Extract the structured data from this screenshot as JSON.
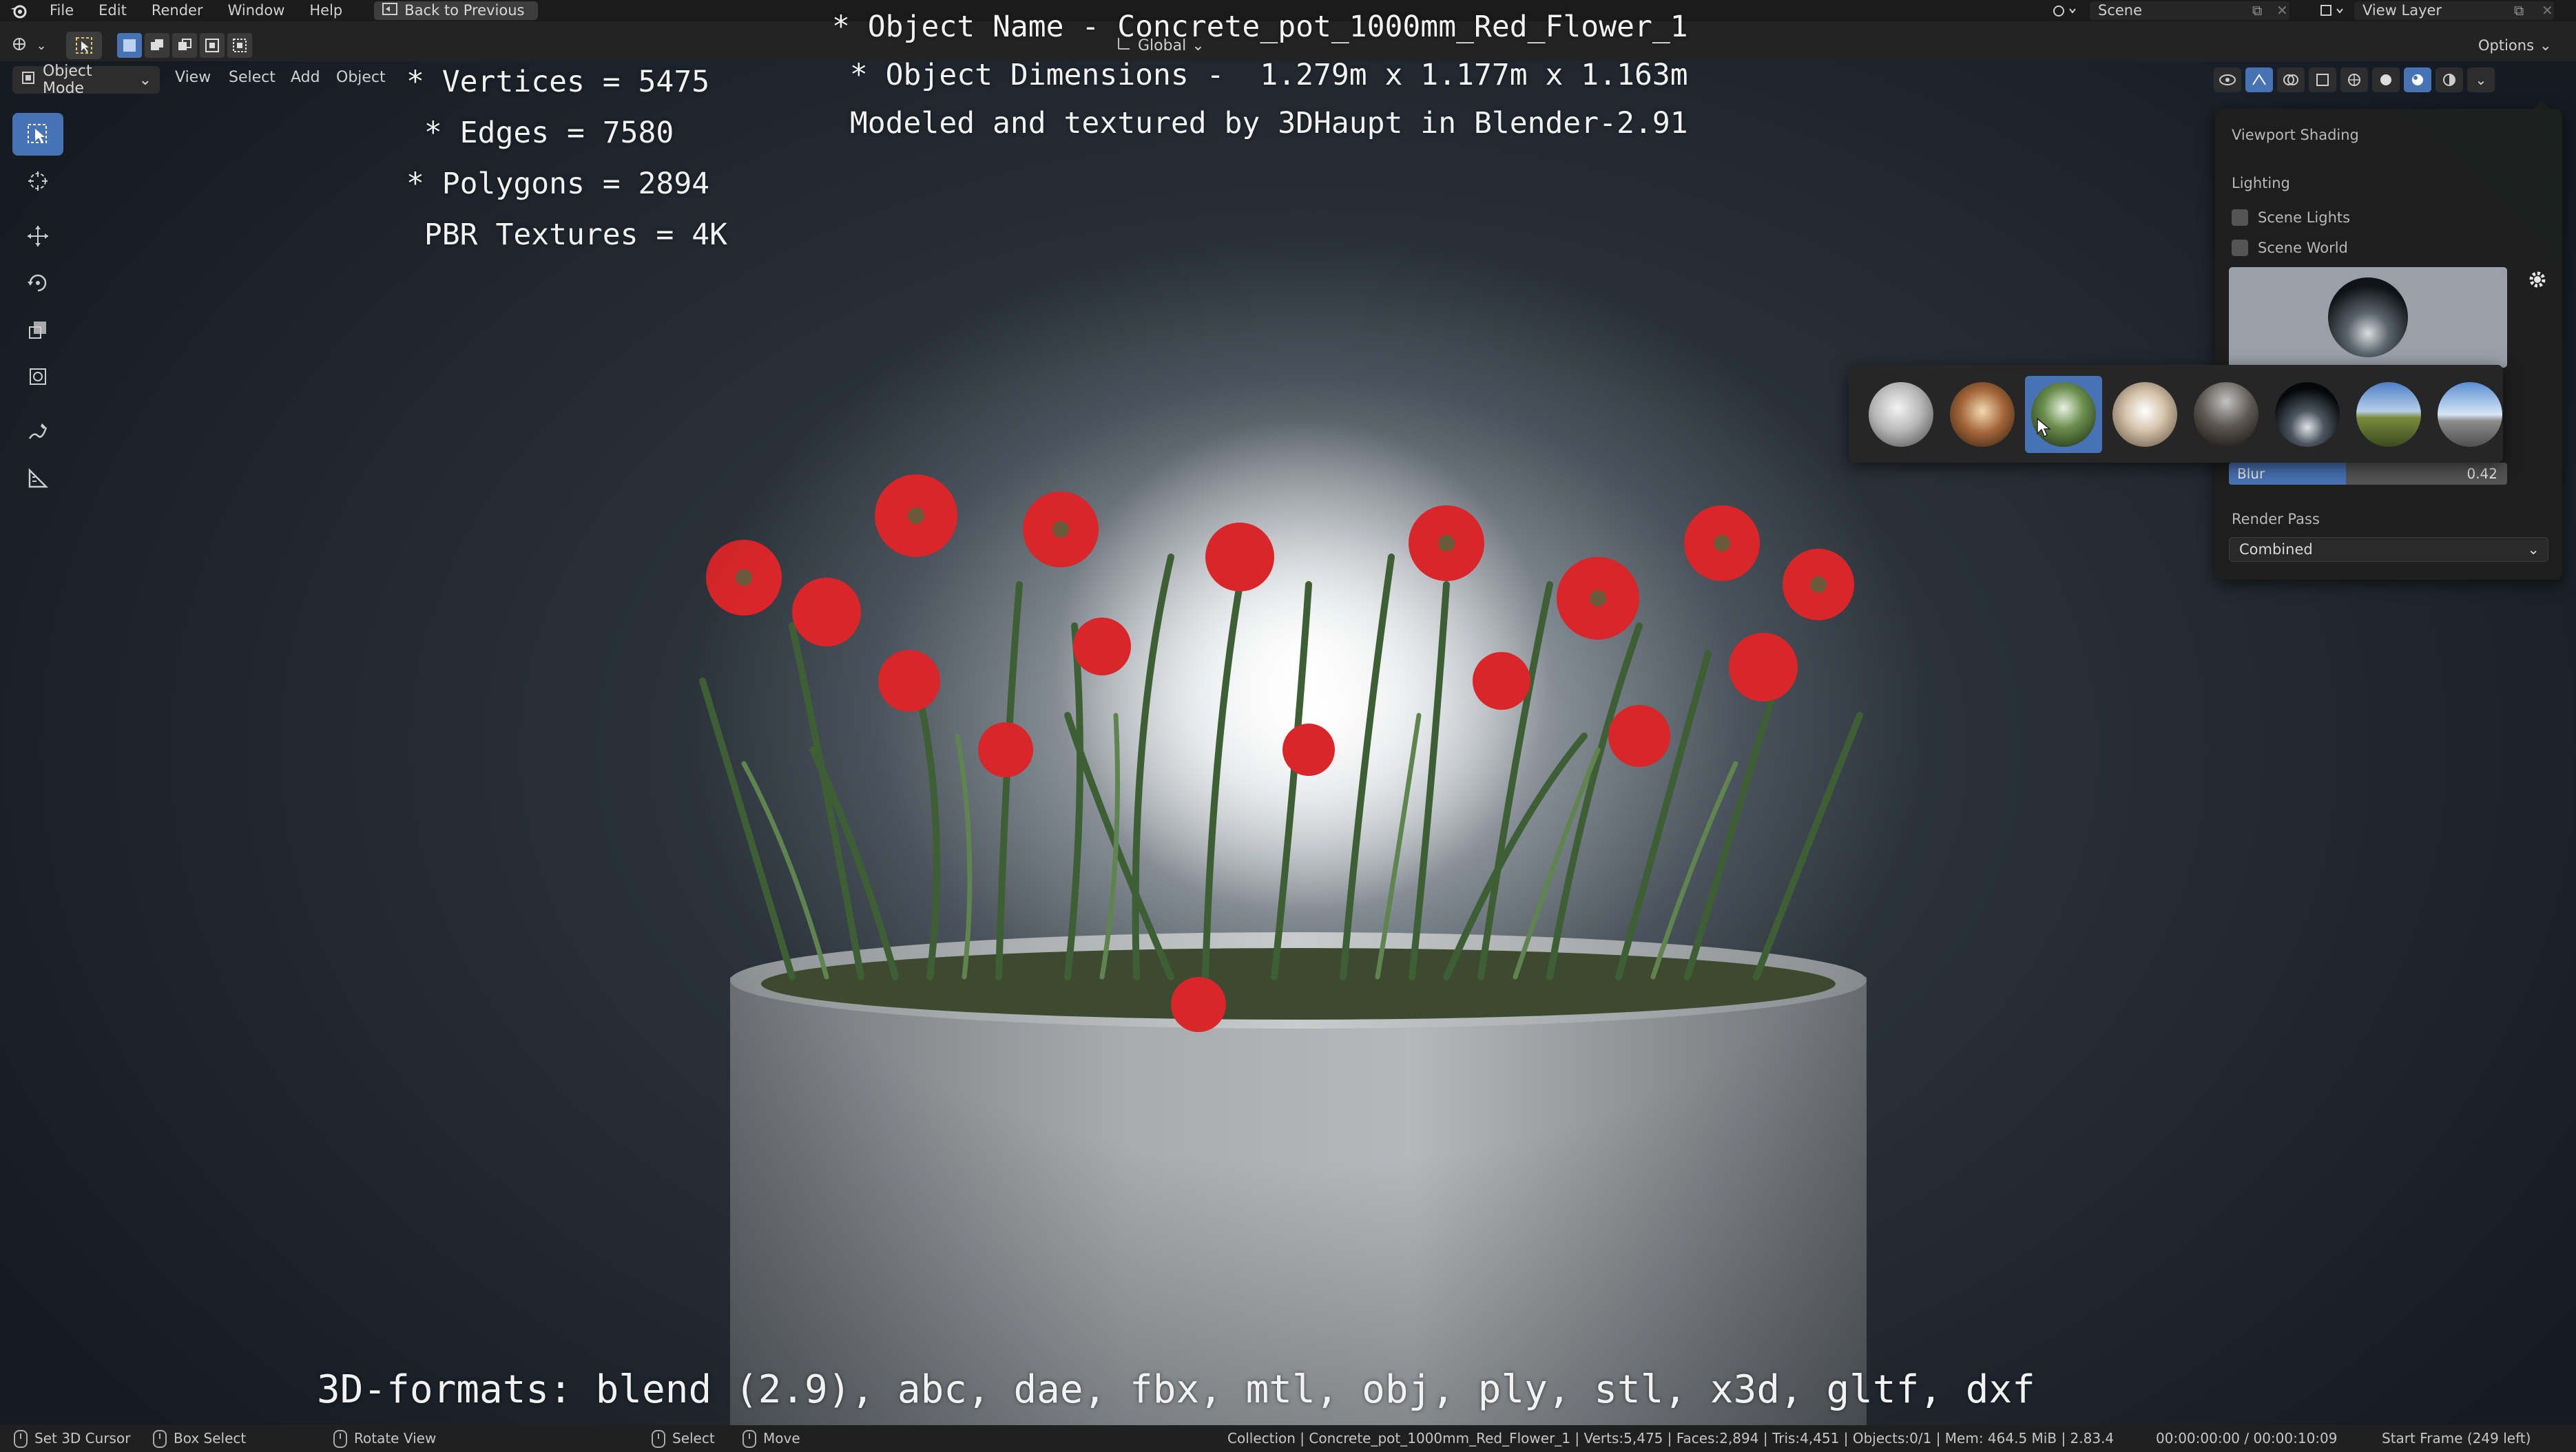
{
  "topbar": {
    "menus": [
      "File",
      "Edit",
      "Render",
      "Window",
      "Help"
    ],
    "back_button": "Back to Previous",
    "scene": "Scene",
    "view_layer": "View Layer"
  },
  "header": {
    "mode": "Object Mode",
    "menus": [
      "View",
      "Select",
      "Add",
      "Object"
    ],
    "orientation": "Global",
    "options_label": "Options"
  },
  "overlay": {
    "stats": [
      "* Vertices = 5475",
      " * Edges = 7580",
      "* Polygons = 2894",
      " PBR Textures = 4K"
    ],
    "object_name": "* Object Name - Concrete_pot_1000mm_Red_Flower_1",
    "object_dimensions": " * Object Dimensions -  1.279m x 1.177m x 1.163m",
    "credit": " Modeled and textured by 3DHaupt in Blender-2.91",
    "formats": "3D-formats: blend (2.9), abc, dae, fbx, mtl, obj, ply, stl, x3d, gltf, dxf"
  },
  "shading_popover": {
    "title": "Viewport Shading",
    "lighting_label": "Lighting",
    "scene_lights": "Scene Lights",
    "scene_world": "Scene World",
    "blur_label": "Blur",
    "blur_value": "0.42",
    "blur_fraction": 0.42,
    "render_pass_label": "Render Pass",
    "render_pass": "Combined"
  },
  "hdri_picker": {
    "selected_index": 2,
    "count": 8
  },
  "statusbar": {
    "set_cursor": "Set 3D Cursor",
    "box_select": "Box Select",
    "rotate_view": "Rotate View",
    "select": "Select",
    "move": "Move",
    "info": "Collection | Concrete_pot_1000mm_Red_Flower_1 | Verts:5,475 | Faces:2,894 | Tris:4,451 | Objects:0/1 | Mem: 464.5 MiB | 2.83.4",
    "time": "00:00:00:00 / 00:00:10:09",
    "frame": "Start Frame (249 left)"
  },
  "colors": {
    "accent": "#4772b3",
    "flower_red": "#d8262b",
    "pot_gray": "#9a9a9a"
  }
}
